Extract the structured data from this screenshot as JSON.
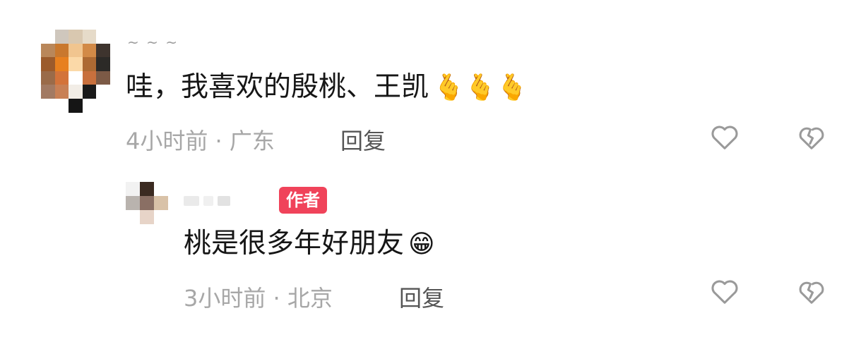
{
  "comments": [
    {
      "username": "~ ~ ~",
      "text": "哇，我喜欢的殷桃、王凯",
      "emoji": "🫰🫰🫰",
      "time_location": "4小时前 · 广东",
      "reply_label": "回复",
      "like_icon": "heart-outline-icon",
      "dislike_icon": "broken-heart-icon"
    },
    {
      "badge": "作者",
      "text": "桃是很多年好朋友",
      "emoji": "😁",
      "time_location": "3小时前 · 北京",
      "reply_label": "回复",
      "like_icon": "heart-outline-icon",
      "dislike_icon": "broken-heart-icon"
    }
  ],
  "colors": {
    "badge_bg": "#f0435a",
    "meta_text": "#a7a7a7",
    "main_text": "#161616"
  }
}
